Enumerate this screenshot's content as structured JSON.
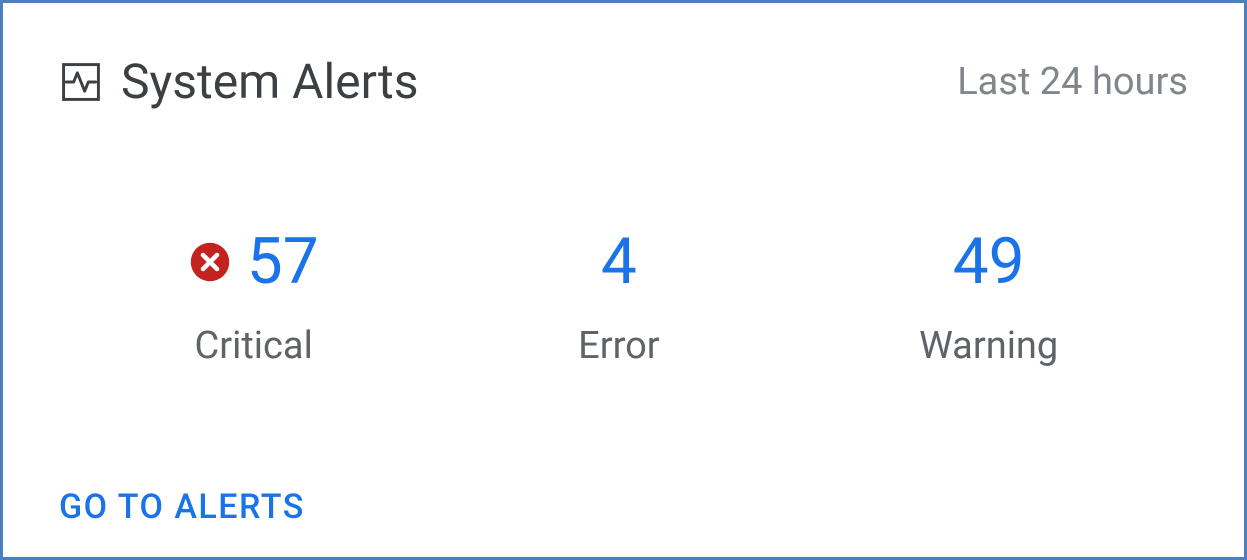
{
  "header": {
    "title": "System Alerts",
    "time_range": "Last 24 hours"
  },
  "stats": {
    "critical": {
      "value": "57",
      "label": "Critical"
    },
    "error": {
      "value": "4",
      "label": "Error"
    },
    "warning": {
      "value": "49",
      "label": "Warning"
    }
  },
  "footer": {
    "go_to_alerts": "GO TO ALERTS"
  },
  "colors": {
    "accent": "#1a73e8",
    "critical_icon": "#c5221f",
    "text_primary": "#3c4043",
    "text_secondary": "#5f6368",
    "border": "#4b7fbf"
  }
}
